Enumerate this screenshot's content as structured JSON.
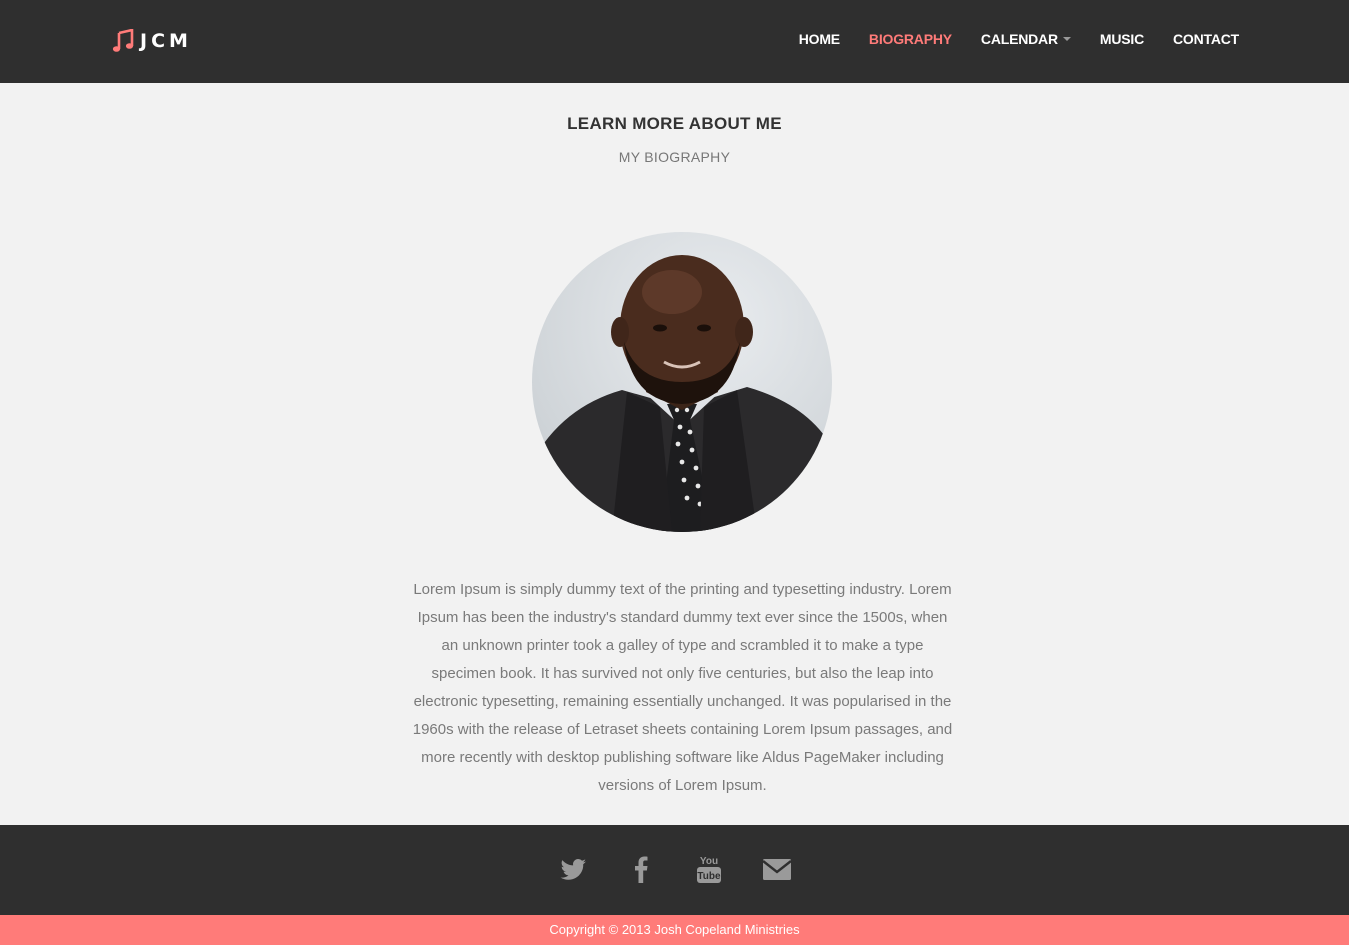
{
  "brand": {
    "text": "JCM",
    "icon": "music-note-icon"
  },
  "nav": {
    "items": [
      {
        "label": "HOME",
        "active": false
      },
      {
        "label": "BIOGRAPHY",
        "active": true
      },
      {
        "label": "CALENDAR",
        "active": false,
        "dropdown": true
      },
      {
        "label": "MUSIC",
        "active": false
      },
      {
        "label": "CONTACT",
        "active": false
      }
    ]
  },
  "main": {
    "title": "LEARN MORE ABOUT ME",
    "subtitle": "MY BIOGRAPHY",
    "bio": "Lorem Ipsum is simply dummy text of the printing and typesetting industry. Lorem Ipsum has been the industry's standard dummy text ever since the 1500s, when an unknown printer took a galley of type and scrambled it to make a type specimen book. It has survived not only five centuries, but also the leap into electronic typesetting, remaining essentially unchanged. It was popularised in the 1960s with the release of Letraset sheets containing Lorem Ipsum passages, and more recently with desktop publishing software like Aldus PageMaker including versions of Lorem Ipsum."
  },
  "footer": {
    "social": [
      "twitter-icon",
      "facebook-icon",
      "youtube-icon",
      "email-icon"
    ],
    "copyright": "Copyright © 2013 Josh Copeland Ministries"
  },
  "colors": {
    "accent": "#ff7b79",
    "dark": "#2f2f2f",
    "background": "#f2f2f2"
  }
}
